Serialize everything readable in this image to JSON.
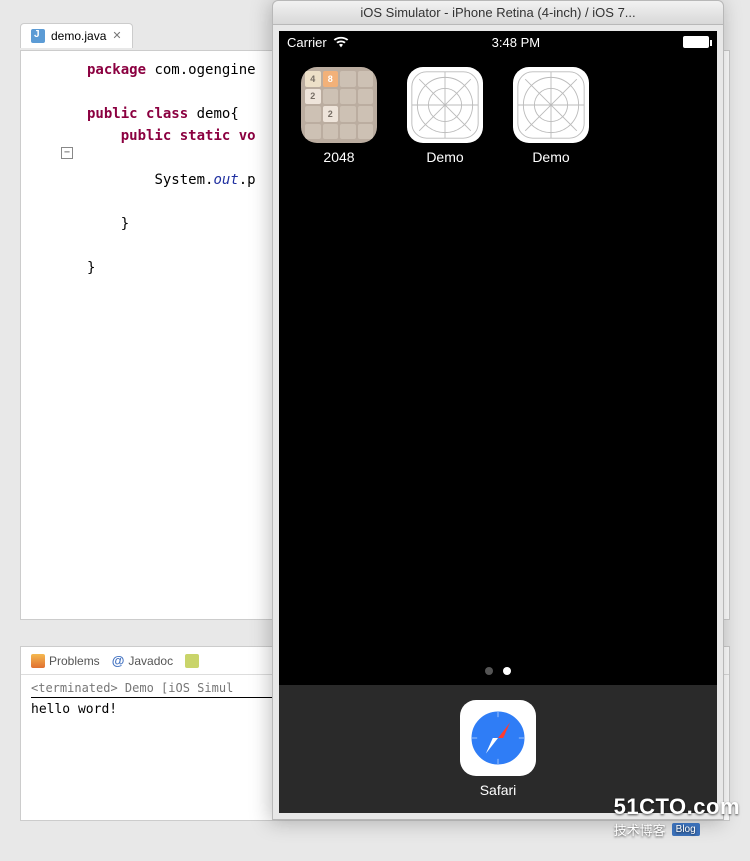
{
  "editor": {
    "tab_name": "demo.java",
    "tab_close": "✕",
    "code": {
      "kw_package": "package",
      "pkg_name": "com.ogengine",
      "kw_public1": "public",
      "kw_class": "class",
      "class_name": "demo",
      "brace_open": "{",
      "kw_public2": "public",
      "kw_static": "static",
      "kw_vo": "vo",
      "system": "System.",
      "out": "out",
      "dot_p": ".p",
      "brace_close1": "}",
      "brace_close2": "}"
    }
  },
  "bottom": {
    "tab_problems": "Problems",
    "tab_javadoc": "Javadoc",
    "console_header": "<terminated> Demo [iOS Simul",
    "console_out": "hello word!"
  },
  "simulator": {
    "title": "iOS Simulator - iPhone Retina (4-inch) / iOS 7...",
    "carrier": "Carrier",
    "time": "3:48 PM",
    "apps": [
      {
        "label": "2048",
        "kind": "2048"
      },
      {
        "label": "Demo",
        "kind": "placeholder"
      },
      {
        "label": "Demo",
        "kind": "placeholder"
      }
    ],
    "dock_app": "Safari"
  },
  "watermark": {
    "domain": "51CTO.com",
    "tagline": "技术博客",
    "badge": "Blog"
  }
}
